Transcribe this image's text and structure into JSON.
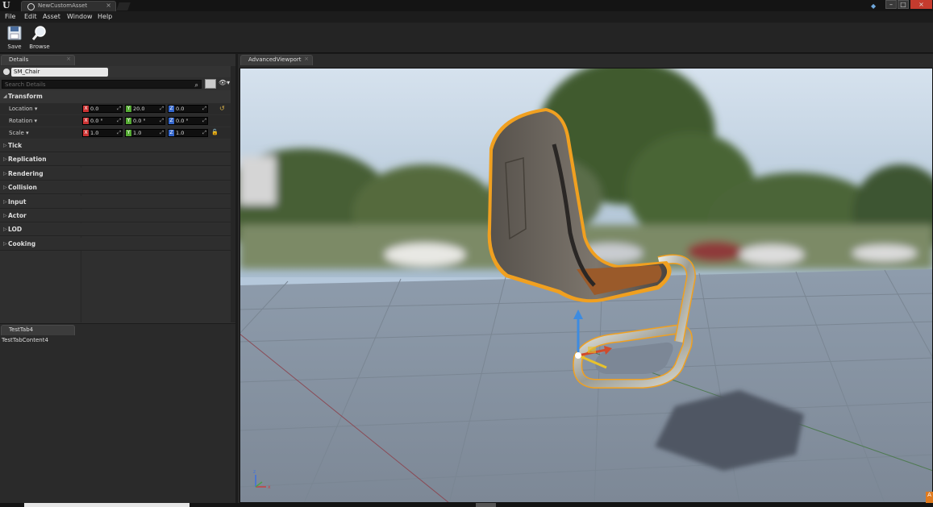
{
  "window": {
    "tab_title": "NewCustomAsset",
    "tab_close": "×",
    "controls": {
      "minimize": "–",
      "maximize": "□",
      "close": "×"
    }
  },
  "menu": [
    "File",
    "Edit",
    "Asset",
    "Window",
    "Help"
  ],
  "toolbar": {
    "save_label": "Save",
    "browse_label": "Browse"
  },
  "details": {
    "tab_label": "Details",
    "tab_close": "×",
    "object_name": "SM_Chair",
    "search_placeholder": "Search Details",
    "transform": {
      "label": "Transform",
      "rows": [
        {
          "name": "Location",
          "x": "0.0",
          "y": "20.0",
          "z": "0.0"
        },
        {
          "name": "Rotation",
          "x": "0.0 °",
          "y": "0.0 °",
          "z": "0.0 °"
        },
        {
          "name": "Scale",
          "x": "1.0",
          "y": "1.0",
          "z": "1.0"
        }
      ]
    },
    "categories": [
      "Tick",
      "Replication",
      "Rendering",
      "Collision",
      "Input",
      "Actor",
      "LOD",
      "Cooking"
    ]
  },
  "testtab": {
    "tab_label": "TestTab4",
    "content": "TestTabContent4"
  },
  "viewport": {
    "tab_label": "AdvancedViewport",
    "tab_close": "×"
  },
  "colors": {
    "selection_outline": "#f0a020",
    "axis_x": "#cc3333",
    "axis_y": "#55aa33",
    "axis_z": "#3366cc"
  }
}
